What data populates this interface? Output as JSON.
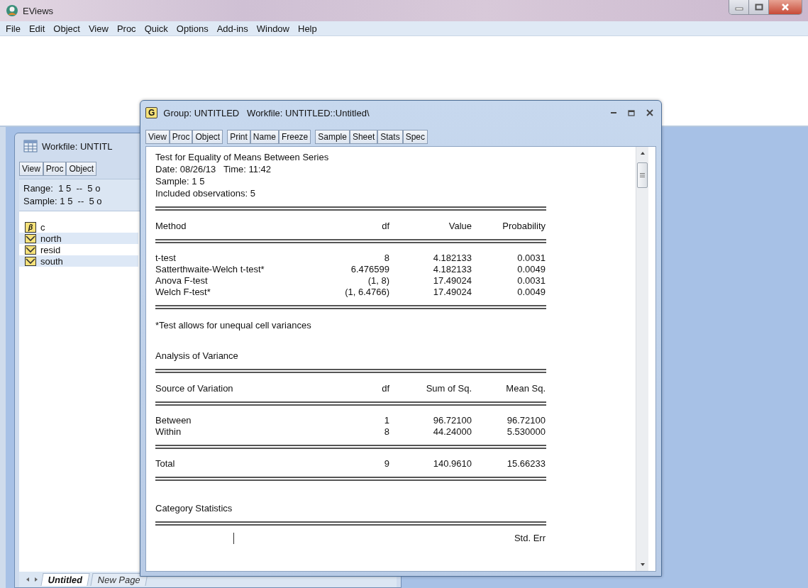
{
  "app_window": {
    "title": "EViews",
    "menu": [
      "File",
      "Edit",
      "Object",
      "View",
      "Proc",
      "Quick",
      "Options",
      "Add-ins",
      "Window",
      "Help"
    ]
  },
  "workfile_window": {
    "title": "Workfile: UNTITL",
    "toolbar": [
      "View",
      "Proc",
      "Object"
    ],
    "range": "Range:  1 5  --  5 o",
    "sample": "Sample: 1 5  --  5 o",
    "objects": [
      {
        "kind": "coefficient",
        "symbol": "β",
        "name": "c",
        "selected": false
      },
      {
        "kind": "series",
        "name": "north",
        "selected": true
      },
      {
        "kind": "series",
        "name": "resid",
        "selected": false
      },
      {
        "kind": "series",
        "name": "south",
        "selected": true
      }
    ],
    "page_tabs": [
      {
        "label": "Untitled",
        "selected": true
      },
      {
        "label": "New Page",
        "selected": false
      }
    ]
  },
  "group_window": {
    "badge": "G",
    "title": "Group: UNTITLED   Workfile: UNTITLED::Untitled\\",
    "toolbar": [
      [
        "View",
        "Proc",
        "Object"
      ],
      [
        "Print",
        "Name",
        "Freeze"
      ],
      [
        "Sample",
        "Sheet",
        "Stats",
        "Spec"
      ]
    ],
    "output": [
      {
        "kind": "text",
        "text": "Test for Equality of Means Between Series"
      },
      {
        "kind": "text",
        "text": "Date: 08/26/13   Time: 11:42"
      },
      {
        "kind": "text",
        "text": "Sample: 1 5"
      },
      {
        "kind": "text",
        "text": "Included observations: 5"
      },
      {
        "kind": "rule"
      },
      {
        "kind": "header",
        "cells": [
          "Method",
          "df",
          "Value",
          "Probability"
        ]
      },
      {
        "kind": "rule"
      },
      {
        "kind": "row",
        "cells": [
          "t-test",
          "8",
          "4.182133",
          "0.0031"
        ]
      },
      {
        "kind": "row",
        "cells": [
          "Satterthwaite-Welch t-test*",
          "6.476599",
          "4.182133",
          "0.0049"
        ]
      },
      {
        "kind": "row",
        "cells": [
          "Anova F-test",
          "(1, 8)",
          "17.49024",
          "0.0031"
        ]
      },
      {
        "kind": "row",
        "cells": [
          "Welch F-test*",
          "(1, 6.4766)",
          "17.49024",
          "0.0049"
        ]
      },
      {
        "kind": "rule"
      },
      {
        "kind": "note",
        "text": "*Test allows for unequal cell variances"
      },
      {
        "kind": "heading",
        "text": "Analysis of Variance"
      },
      {
        "kind": "rule"
      },
      {
        "kind": "header",
        "cells": [
          "Source of Variation",
          "df",
          "Sum of Sq.",
          "Mean Sq."
        ]
      },
      {
        "kind": "rule"
      },
      {
        "kind": "row",
        "cells": [
          "Between",
          "1",
          "96.72100",
          "96.72100"
        ]
      },
      {
        "kind": "row",
        "cells": [
          "Within",
          "8",
          "44.24000",
          "5.530000"
        ]
      },
      {
        "kind": "rule"
      },
      {
        "kind": "row",
        "cells": [
          "Total",
          "9",
          "140.9610",
          "15.66233"
        ]
      },
      {
        "kind": "rule"
      },
      {
        "kind": "heading",
        "text": "Category Statistics"
      },
      {
        "kind": "rule"
      },
      {
        "kind": "partial",
        "last": "Std. Err"
      }
    ]
  }
}
